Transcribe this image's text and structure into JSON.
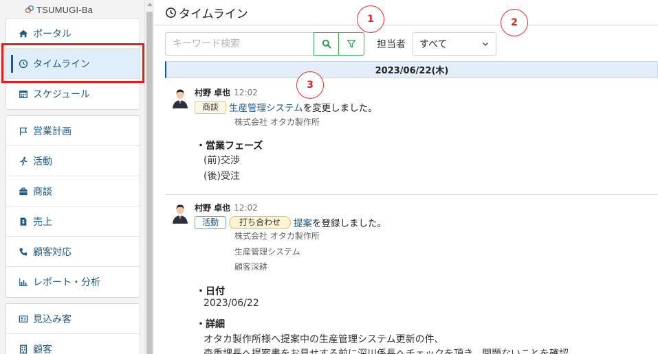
{
  "app": {
    "logo_text": "TSUMUGI-Ba"
  },
  "sidebar": {
    "groups": [
      {
        "items": [
          {
            "id": "portal",
            "label": "ポータル",
            "icon": "home-icon"
          },
          {
            "id": "timeline",
            "label": "タイムライン",
            "icon": "clock-icon",
            "active": true
          },
          {
            "id": "schedule",
            "label": "スケジュール",
            "icon": "calendar-icon"
          }
        ]
      },
      {
        "items": [
          {
            "id": "sales-plan",
            "label": "営業計画",
            "icon": "flag-icon"
          },
          {
            "id": "activity",
            "label": "活動",
            "icon": "running-person-icon"
          },
          {
            "id": "deals",
            "label": "商談",
            "icon": "briefcase-icon"
          },
          {
            "id": "revenue",
            "label": "売上",
            "icon": "invoice-icon"
          },
          {
            "id": "customer-support",
            "label": "顧客対応",
            "icon": "phone-icon"
          },
          {
            "id": "reports",
            "label": "レポート・分析",
            "icon": "bar-chart-icon"
          }
        ]
      },
      {
        "items": [
          {
            "id": "prospects",
            "label": "見込み客",
            "icon": "id-card-icon"
          },
          {
            "id": "customers",
            "label": "顧客",
            "icon": "building-icon"
          }
        ]
      }
    ]
  },
  "header": {
    "title": "タイムライン"
  },
  "filters": {
    "search_placeholder": "キーワード検索",
    "assignee_label": "担当者",
    "assignee_value": "すべて"
  },
  "timeline": {
    "date": "2023/06/22(木)",
    "entries": [
      {
        "author": "村野 卓也",
        "time": "12:02",
        "tag": "商談",
        "link": "生産管理システム",
        "action": "を変更しました。",
        "meta": [
          "株式会社 オタカ製作所"
        ],
        "section_title": "・営業フェーズ",
        "lines": [
          "(前)交渉",
          "(後)受注"
        ]
      },
      {
        "author": "村野 卓也",
        "time": "12:02",
        "tag": "活動",
        "subtag": "打ち合わせ",
        "link": "提案",
        "action": "を登録しました。",
        "meta": [
          "株式会社 オタカ製作所",
          "生産管理システム",
          "顧客深耕"
        ],
        "date_title": "・日付",
        "date_value": "2023/06/22",
        "detail_title": "・詳細",
        "detail_lines": [
          "オタカ製作所様へ提案中の生産管理システム更新の件、",
          "森重課長へ提案書をお見せする前に深川係長へチェックを頂き、問題ないことを確認"
        ]
      }
    ]
  },
  "callouts": [
    "1",
    "2",
    "3"
  ]
}
